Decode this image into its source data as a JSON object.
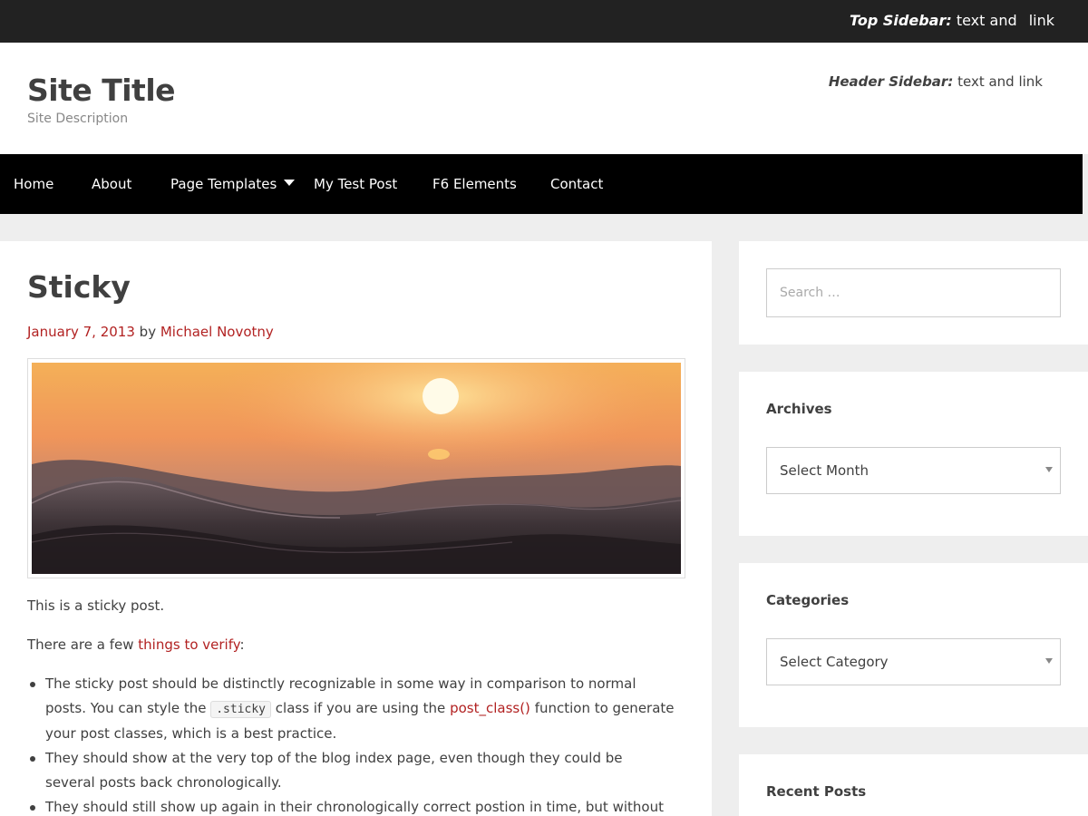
{
  "top_sidebar": {
    "label": "Top Sidebar:",
    "text": "text and",
    "link": "link"
  },
  "header": {
    "site_title": "Site Title",
    "site_description": "Site Description",
    "sidebar_label": "Header Sidebar:",
    "sidebar_text": "text and link"
  },
  "nav": {
    "items": [
      {
        "label": "Home"
      },
      {
        "label": "About"
      },
      {
        "label": "Page Templates"
      },
      {
        "label": "My Test Post"
      },
      {
        "label": "F6 Elements"
      },
      {
        "label": "Contact"
      }
    ]
  },
  "post": {
    "title": "Sticky",
    "date": "January 7, 2013",
    "by": "by",
    "author": "Michael Novotny",
    "intro": "This is a sticky post.",
    "verify_prefix": "There are a few",
    "verify_link": "things to verify",
    "verify_suffix": ":",
    "list": [
      {
        "a": "The sticky post should be distinctly recognizable in some way in comparison to normal posts. You can style the",
        "code": ".sticky",
        "b": "class if you are using the",
        "link": "post_class()",
        "c": "function to generate your post classes, which is a best practice."
      },
      {
        "text": "They should show at the very top of the blog index page, even though they could be several posts back chronologically."
      },
      {
        "text": "They should still show up again in their chronologically correct postion in time, but without the"
      }
    ]
  },
  "sidebar": {
    "search_placeholder": "Search …",
    "archives": {
      "title": "Archives",
      "selected": "Select Month"
    },
    "categories": {
      "title": "Categories",
      "selected": "Select Category"
    },
    "recent_posts": {
      "title": "Recent Posts"
    }
  },
  "icons": {
    "featured_image": "sunset-ocean-wave-image",
    "dropdown": "caret-down-icon"
  }
}
